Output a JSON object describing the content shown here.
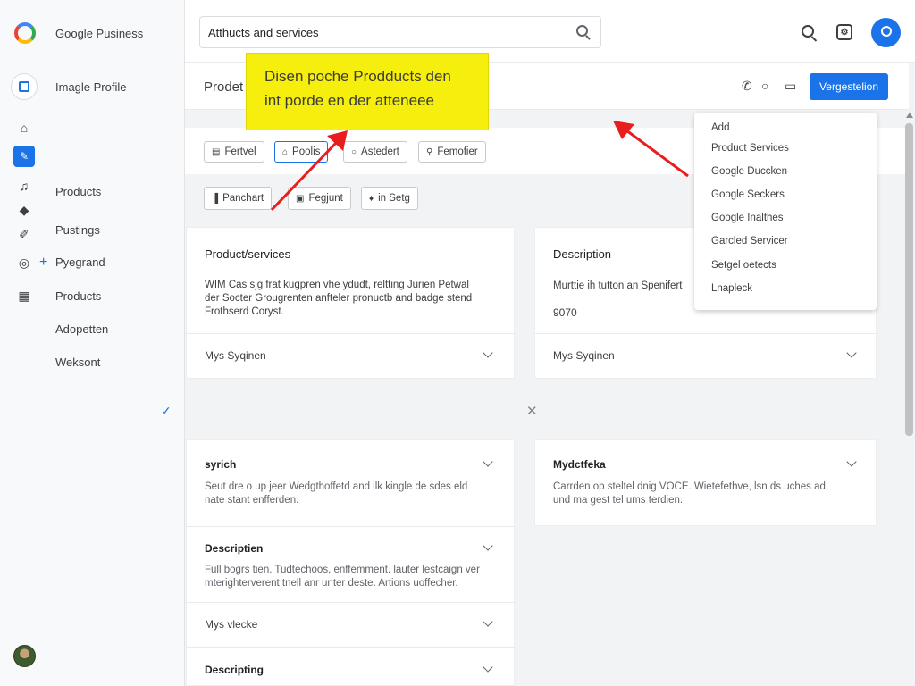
{
  "app": {
    "brand": "Google Pusiness",
    "profile": "Imagle Profile"
  },
  "sidebar": {
    "items": [
      {
        "label": "Products",
        "icon": "music-note-icon"
      },
      {
        "label": "Pustings",
        "icon": "edit-icon"
      },
      {
        "label": "Pyegrand",
        "icon": "google-circle-icon"
      },
      {
        "label": "Products",
        "icon": "grid-icon"
      },
      {
        "label": "Adopetten"
      },
      {
        "label": "Weksont"
      }
    ],
    "icons": [
      "home-icon",
      "active-page-icon",
      "music-note-icon",
      "shapes-icon",
      "edit-icon",
      "google-circle-icon",
      "grid-icon"
    ]
  },
  "header": {
    "search_value": "Atthucts and services"
  },
  "subheader": {
    "title": "Prodet",
    "primary_button": "Vergestelion"
  },
  "callout": {
    "text": "Disen poche Prodducts den int porde en der atteneee"
  },
  "chips": {
    "row1": [
      {
        "label": "Fertvel",
        "icon": "list-icon"
      },
      {
        "label": "Poolis",
        "icon": "store-icon",
        "selected": true
      },
      {
        "label": "Astedert",
        "icon": "circle-icon"
      },
      {
        "label": "Femofier",
        "icon": "search-icon"
      }
    ],
    "row2": [
      {
        "label": "Panchart",
        "icon": "bar-icon"
      },
      {
        "label": "Fegjunt",
        "icon": "calendar-icon"
      },
      {
        "label": "in Setg",
        "icon": "thumb-icon"
      }
    ]
  },
  "card1": {
    "title": "Product/services",
    "body_lines": [
      "WIM Cas sjg frat kugpren vhe ydudt, reltting Jurien Petwal",
      "der Socter Grougrenten anfteler pronuctb and badge stend",
      "Frothserd Coryst."
    ],
    "row": "Mys Syqinen"
  },
  "card2": {
    "title": "Description",
    "body": "Murttie ih tutton an Spenifert",
    "value": "9070",
    "row": "Mys Syqinen"
  },
  "card3": {
    "title": "syrich",
    "body_lines": [
      "Seut dre o up jeer Wedgthoffetd and llk kingle de sdes eld",
      "nate stant enfferden."
    ],
    "section2_title": "Descriptien",
    "section2_lines": [
      "Full bogrs tien. Tudtechoos, enffemment. lauter lestcaign ver",
      "mterighterverent tnell anr unter deste. Artions uoffecher."
    ],
    "row": "Mys vlecke",
    "section3_title": "Descripting"
  },
  "card4": {
    "title": "Mydctfeka",
    "body_lines": [
      "Carrden op steltel dnig VOCE. Wietefethve, lsn ds uches ad",
      "und ma gest tel ums terdien."
    ]
  },
  "dropdown": {
    "items": [
      "Add",
      "Product Services",
      "Google Duccken",
      "Google Seckers",
      "Google Inalthes",
      "Garcled Servicer",
      "Setgel oetects",
      "Lnapleck"
    ]
  },
  "colors": {
    "accent": "#1a73e8",
    "callout": "#f6ee0d",
    "arrow": "#e81d1d"
  }
}
